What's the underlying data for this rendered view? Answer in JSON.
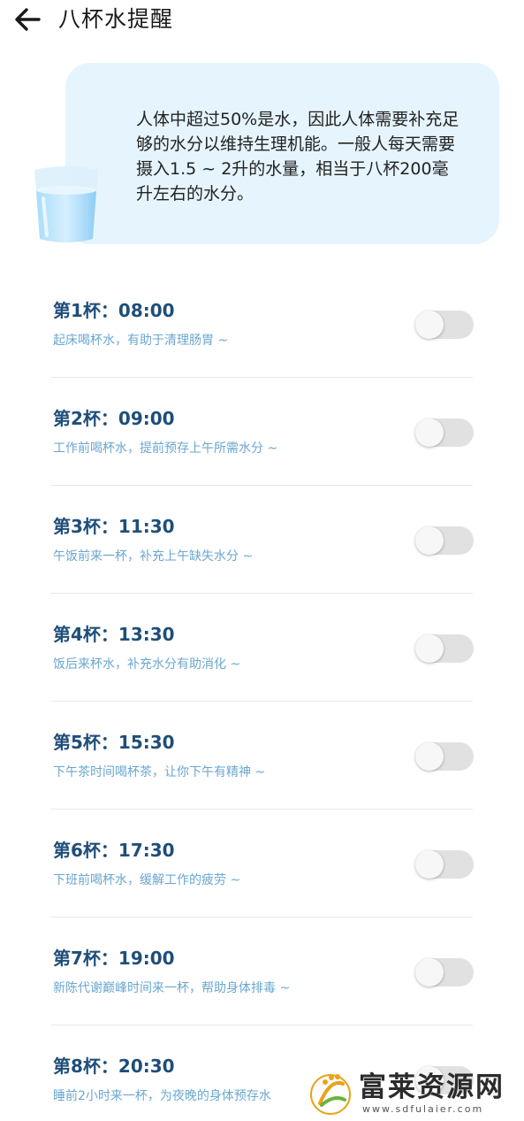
{
  "header": {
    "title": "八杯水提醒",
    "back_icon": "arrow-left-icon"
  },
  "info": {
    "text": "人体中超过50%是水，因此人体需要补充足够的水分以维持生理机能。一般人每天需要摄入1.5 ~ 2升的水量，相当于八杯200毫升左右的水分。",
    "icon": "water-glass-icon"
  },
  "cups": [
    {
      "title": "第1杯：08:00",
      "desc": "起床喝杯水，有助于清理肠胃 ~",
      "enabled": false
    },
    {
      "title": "第2杯：09:00",
      "desc": "工作前喝杯水，提前预存上午所需水分 ~",
      "enabled": false
    },
    {
      "title": "第3杯：11:30",
      "desc": "午饭前来一杯，补充上午缺失水分 ~",
      "enabled": false
    },
    {
      "title": "第4杯：13:30",
      "desc": "饭后来杯水，补充水分有助消化 ~",
      "enabled": false
    },
    {
      "title": "第5杯：15:30",
      "desc": "下午茶时间喝杯茶，让你下午有精神 ~",
      "enabled": false
    },
    {
      "title": "第6杯：17:30",
      "desc": "下班前喝杯水，缓解工作的疲劳 ~",
      "enabled": false
    },
    {
      "title": "第7杯：19:00",
      "desc": "新陈代谢巅峰时间来一杯，帮助身体排毒 ~",
      "enabled": false
    },
    {
      "title": "第8杯：20:30",
      "desc": "睡前2小时来一杯，为夜晚的身体预存水",
      "enabled": false
    }
  ],
  "watermark": {
    "name": "富莱资源网",
    "url": "www.sdfulaier.com"
  },
  "colors": {
    "accent_title": "#1f4e7a",
    "desc": "#6aa7d0",
    "card_bg": "#e6f4fd",
    "toggle_off": "#e1e1e1"
  }
}
